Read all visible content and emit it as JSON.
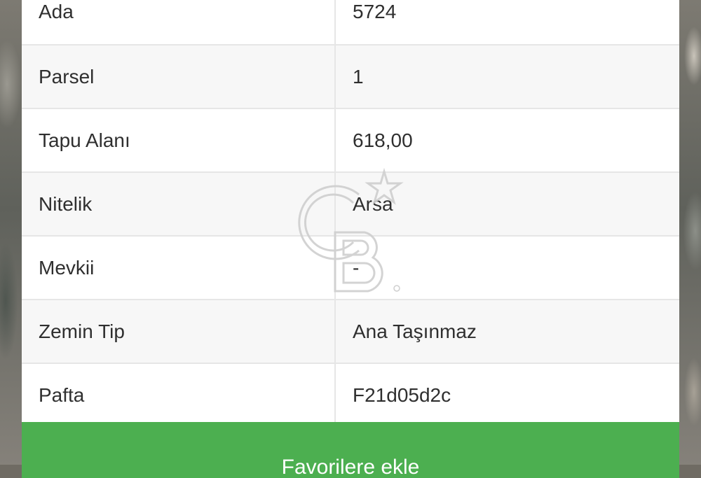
{
  "property_details": {
    "rows": [
      {
        "label": "Ada",
        "value": "5724"
      },
      {
        "label": "Parsel",
        "value": "1"
      },
      {
        "label": "Tapu Alanı",
        "value": "618,00"
      },
      {
        "label": "Nitelik",
        "value": "Arsa"
      },
      {
        "label": "Mevkii",
        "value": "-"
      },
      {
        "label": "Zemin Tip",
        "value": "Ana Taşınmaz"
      },
      {
        "label": "Pafta",
        "value": "F21d05d2c"
      }
    ]
  },
  "actions": {
    "add_favorites_label": "Favorilere ekle"
  },
  "watermark": {
    "icon": "cb-logo-icon",
    "text": "CB"
  },
  "colors": {
    "accent_green": "#4caf50"
  }
}
